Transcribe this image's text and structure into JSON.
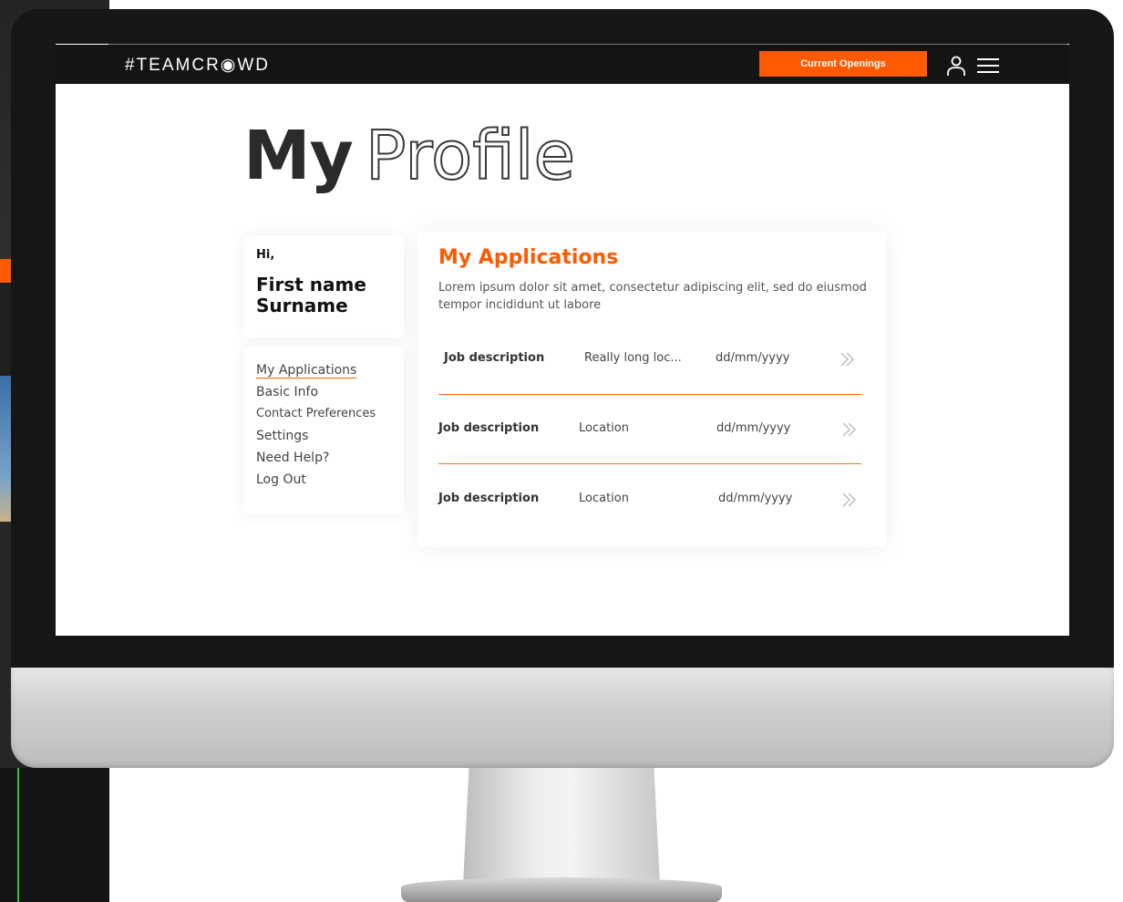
{
  "navbar": {
    "logo": "#TEAMCR◉WD",
    "cta_label": "Current Openings"
  },
  "page": {
    "title_bold": "My",
    "title_outline": "Profile"
  },
  "profile": {
    "greeting": "Hi,",
    "first_name": "First name",
    "surname": "Surname"
  },
  "menu": {
    "items": [
      {
        "label": "My Applications"
      },
      {
        "label": "Basic Info"
      },
      {
        "label": "Contact Preferences"
      },
      {
        "label": "Settings"
      },
      {
        "label": "Need Help?"
      },
      {
        "label": "Log Out"
      }
    ]
  },
  "applications": {
    "title": "My Applications",
    "description": "Lorem ipsum dolor sit amet, consectetur adipiscing elit, sed do eiusmod tempor incididunt ut labore",
    "rows": [
      {
        "job": "Job description",
        "location": "Really long loc...",
        "date": "dd/mm/yyyy"
      },
      {
        "job": "Job description",
        "location": "Location",
        "date": "dd/mm/yyyy"
      },
      {
        "job": "Job description",
        "location": "Location",
        "date": "dd/mm/yyyy"
      }
    ]
  },
  "colors": {
    "accent": "#ff5a00",
    "nav_bg": "#141414",
    "text_dark": "#2b2b2b"
  },
  "icons": {
    "user": "user-icon",
    "menu": "hamburger-menu-icon",
    "row_arrow": "double-chevron-right-icon"
  }
}
